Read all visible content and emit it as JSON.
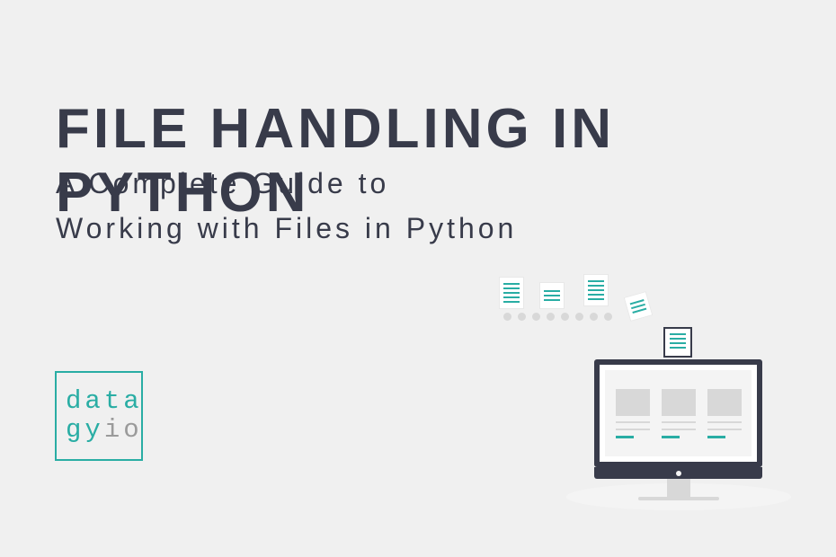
{
  "heading": "FILE HANDLING IN PYTHON",
  "subtitle_line1": "A Complete Guide to",
  "subtitle_line2": "Working with Files in Python",
  "logo": {
    "line1": "data",
    "line2_prefix": "gy",
    "line2_suffix": "io"
  },
  "colors": {
    "accent": "#29ada4",
    "dark": "#383b4a",
    "bg": "#f0f0f0",
    "grey": "#9a9a9a"
  }
}
